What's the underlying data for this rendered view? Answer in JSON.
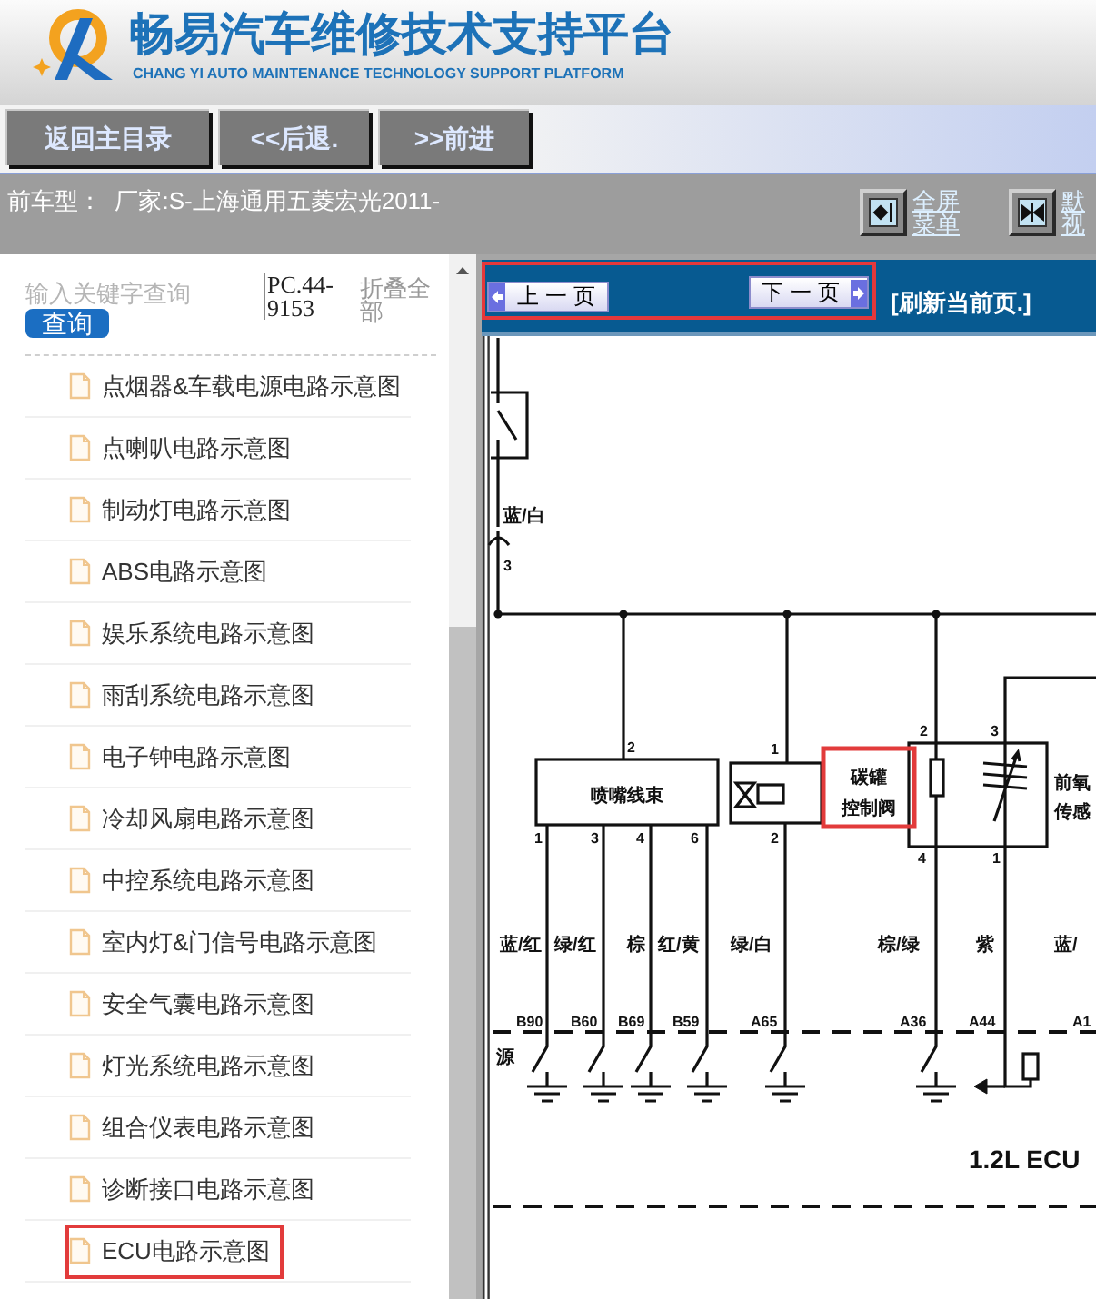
{
  "header": {
    "title": "畅易汽车维修技术支持平台",
    "subtitle": "CHANG YI AUTO MAINTENANCE TECHNOLOGY SUPPORT PLATFORM"
  },
  "nav_buttons": [
    "返回主目录",
    "<<后退.",
    ">>前进"
  ],
  "vehicle_bar": {
    "text": "前车型：  厂家:S-上海通用五菱宏光2011-",
    "view_buttons": [
      {
        "kind": "fullscreen",
        "label_lines": [
          "全屏",
          "菜单"
        ]
      },
      {
        "kind": "default",
        "label_lines": [
          "默",
          "视"
        ]
      }
    ]
  },
  "sidebar": {
    "search": {
      "placeholder": "输入关键字查询",
      "button": "查询"
    },
    "code": "PC.44-9153",
    "collapse": "折叠全部",
    "items": [
      {
        "label": "点烟器&车载电源电路示意图",
        "marked": false
      },
      {
        "label": "点喇叭电路示意图",
        "marked": false
      },
      {
        "label": "制动灯电路示意图",
        "marked": false
      },
      {
        "label": "ABS电路示意图",
        "marked": false
      },
      {
        "label": "娱乐系统电路示意图",
        "marked": false
      },
      {
        "label": "雨刮系统电路示意图",
        "marked": false
      },
      {
        "label": "电子钟电路示意图",
        "marked": false
      },
      {
        "label": "冷却风扇电路示意图",
        "marked": false
      },
      {
        "label": "中控系统电路示意图",
        "marked": false
      },
      {
        "label": "室内灯&门信号电路示意图",
        "marked": false
      },
      {
        "label": "安全气囊电路示意图",
        "marked": false
      },
      {
        "label": "灯光系统电路示意图",
        "marked": false
      },
      {
        "label": "组合仪表电路示意图",
        "marked": false
      },
      {
        "label": "诊断接口电路示意图",
        "marked": false
      },
      {
        "label": "ECU电路示意图",
        "marked": true
      }
    ]
  },
  "viewer": {
    "page_nav": {
      "marked": true,
      "prev": "上 一 页",
      "next": "下 一 页"
    },
    "refresh": "[刷新当前页.]",
    "diagram": {
      "top_wire_color": "蓝/白",
      "top_pin": "3",
      "harness": {
        "label": "喷嘴线束",
        "pin_in": "2",
        "pins_out": [
          "1",
          "3",
          "4",
          "6"
        ]
      },
      "valve": {
        "pin_in": "1",
        "pin_out": "2"
      },
      "valve_label": {
        "lines": [
          "碳罐",
          "控制阀"
        ],
        "marked": true
      },
      "sensor": {
        "pins_in": [
          "2",
          "3"
        ],
        "pins_out": [
          "4",
          "1"
        ],
        "label_lines": [
          "前氧",
          "传感"
        ]
      },
      "wire_colors": [
        "蓝/红",
        "绿/红",
        "棕",
        "红/黄",
        "绿/白",
        "棕/绿",
        "紫",
        "蓝/"
      ],
      "connectors": [
        "B90",
        "B60",
        "B69",
        "B59",
        "A65",
        "A36",
        "A44",
        "A1"
      ],
      "power_label": "源",
      "title": "1.2L ECU"
    }
  }
}
